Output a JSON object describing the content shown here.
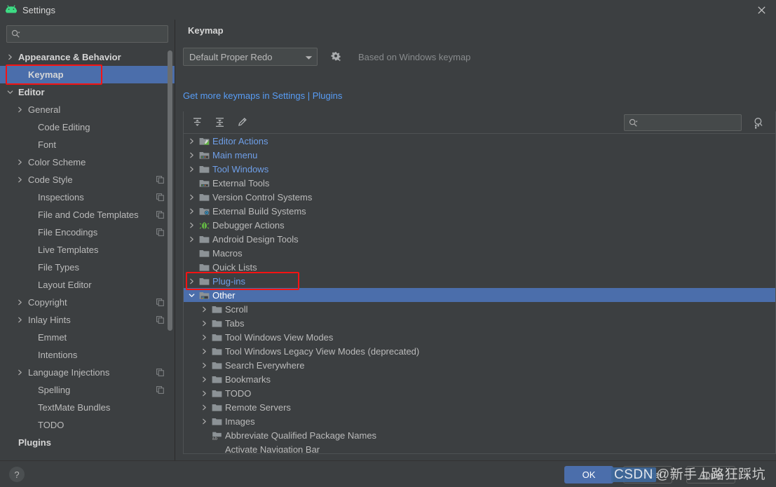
{
  "window": {
    "title": "Settings",
    "logo_icon": "android-studio-logo-icon",
    "close_icon": "close-icon"
  },
  "sidebar": {
    "search": {
      "placeholder": "",
      "value": "",
      "icon": "search-icon"
    },
    "items": [
      {
        "label": "Appearance & Behavior",
        "arrow": "chevron-right",
        "indent": 0,
        "bold": true,
        "selected": false,
        "copy": false
      },
      {
        "label": "Keymap",
        "arrow": "",
        "indent": 1,
        "bold": true,
        "selected": true,
        "copy": false
      },
      {
        "label": "Editor",
        "arrow": "chevron-down",
        "indent": 0,
        "bold": true,
        "selected": false,
        "copy": false
      },
      {
        "label": "General",
        "arrow": "chevron-right",
        "indent": 1,
        "bold": false,
        "selected": false,
        "copy": false
      },
      {
        "label": "Code Editing",
        "arrow": "",
        "indent": 2,
        "bold": false,
        "selected": false,
        "copy": false
      },
      {
        "label": "Font",
        "arrow": "",
        "indent": 2,
        "bold": false,
        "selected": false,
        "copy": false
      },
      {
        "label": "Color Scheme",
        "arrow": "chevron-right",
        "indent": 1,
        "bold": false,
        "selected": false,
        "copy": false
      },
      {
        "label": "Code Style",
        "arrow": "chevron-right",
        "indent": 1,
        "bold": false,
        "selected": false,
        "copy": true
      },
      {
        "label": "Inspections",
        "arrow": "",
        "indent": 2,
        "bold": false,
        "selected": false,
        "copy": true
      },
      {
        "label": "File and Code Templates",
        "arrow": "",
        "indent": 2,
        "bold": false,
        "selected": false,
        "copy": true
      },
      {
        "label": "File Encodings",
        "arrow": "",
        "indent": 2,
        "bold": false,
        "selected": false,
        "copy": true
      },
      {
        "label": "Live Templates",
        "arrow": "",
        "indent": 2,
        "bold": false,
        "selected": false,
        "copy": false
      },
      {
        "label": "File Types",
        "arrow": "",
        "indent": 2,
        "bold": false,
        "selected": false,
        "copy": false
      },
      {
        "label": "Layout Editor",
        "arrow": "",
        "indent": 2,
        "bold": false,
        "selected": false,
        "copy": false
      },
      {
        "label": "Copyright",
        "arrow": "chevron-right",
        "indent": 1,
        "bold": false,
        "selected": false,
        "copy": true
      },
      {
        "label": "Inlay Hints",
        "arrow": "chevron-right",
        "indent": 1,
        "bold": false,
        "selected": false,
        "copy": true
      },
      {
        "label": "Emmet",
        "arrow": "",
        "indent": 2,
        "bold": false,
        "selected": false,
        "copy": false
      },
      {
        "label": "Intentions",
        "arrow": "",
        "indent": 2,
        "bold": false,
        "selected": false,
        "copy": false
      },
      {
        "label": "Language Injections",
        "arrow": "chevron-right",
        "indent": 1,
        "bold": false,
        "selected": false,
        "copy": true
      },
      {
        "label": "Spelling",
        "arrow": "",
        "indent": 2,
        "bold": false,
        "selected": false,
        "copy": true
      },
      {
        "label": "TextMate Bundles",
        "arrow": "",
        "indent": 2,
        "bold": false,
        "selected": false,
        "copy": false
      },
      {
        "label": "TODO",
        "arrow": "",
        "indent": 2,
        "bold": false,
        "selected": false,
        "copy": false
      },
      {
        "label": "Plugins",
        "arrow": "",
        "indent": 0,
        "bold": true,
        "selected": false,
        "copy": false
      }
    ]
  },
  "main": {
    "title": "Keymap",
    "keymap_select": {
      "value": "Default Proper Redo",
      "arrow_icon": "chevron-down-icon"
    },
    "gear_icon": "gear-icon",
    "based_on": "Based on Windows keymap",
    "links": {
      "text": "Get more keymaps in Settings | Plugins"
    },
    "toolbar": {
      "expand_all_icon": "expand-all-icon",
      "collapse_all_icon": "collapse-all-icon",
      "edit_shortcut_icon": "pencil-edit-icon",
      "search_placeholder": "",
      "search_value": "",
      "search_icon": "search-icon",
      "find_actions_icon": "find-action-by-shortcut-icon"
    },
    "tree": [
      {
        "label": "Editor Actions",
        "arrow": "chevron-right",
        "icon": "folder-editor-icon",
        "depth": 0,
        "blue": true,
        "selected": false
      },
      {
        "label": "Main menu",
        "arrow": "chevron-right",
        "icon": "folder-menu-icon",
        "depth": 0,
        "blue": true,
        "selected": false
      },
      {
        "label": "Tool Windows",
        "arrow": "chevron-right",
        "icon": "folder-icon",
        "depth": 0,
        "blue": true,
        "selected": false
      },
      {
        "label": "External Tools",
        "arrow": "",
        "icon": "folder-tools-icon",
        "depth": 0,
        "blue": false,
        "selected": false
      },
      {
        "label": "Version Control Systems",
        "arrow": "chevron-right",
        "icon": "folder-icon",
        "depth": 0,
        "blue": false,
        "selected": false
      },
      {
        "label": "External Build Systems",
        "arrow": "chevron-right",
        "icon": "folder-gear-icon",
        "depth": 0,
        "blue": false,
        "selected": false
      },
      {
        "label": "Debugger Actions",
        "arrow": "chevron-right",
        "icon": "bug-icon",
        "depth": 0,
        "blue": false,
        "selected": false
      },
      {
        "label": "Android Design Tools",
        "arrow": "chevron-right",
        "icon": "folder-icon",
        "depth": 0,
        "blue": false,
        "selected": false
      },
      {
        "label": "Macros",
        "arrow": "",
        "icon": "folder-icon",
        "depth": 0,
        "blue": false,
        "selected": false
      },
      {
        "label": "Quick Lists",
        "arrow": "",
        "icon": "folder-icon",
        "depth": 0,
        "blue": false,
        "selected": false
      },
      {
        "label": "Plug-ins",
        "arrow": "chevron-right",
        "icon": "folder-icon",
        "depth": 0,
        "blue": true,
        "selected": false
      },
      {
        "label": "Other",
        "arrow": "chevron-down",
        "icon": "folder-other-icon",
        "depth": 0,
        "blue": true,
        "selected": true
      },
      {
        "label": "Scroll",
        "arrow": "chevron-right",
        "icon": "folder-icon",
        "depth": 1,
        "blue": false,
        "selected": false
      },
      {
        "label": "Tabs",
        "arrow": "chevron-right",
        "icon": "folder-icon",
        "depth": 1,
        "blue": false,
        "selected": false
      },
      {
        "label": "Tool Windows View Modes",
        "arrow": "chevron-right",
        "icon": "folder-icon",
        "depth": 1,
        "blue": false,
        "selected": false
      },
      {
        "label": "Tool Windows Legacy View Modes (deprecated)",
        "arrow": "chevron-right",
        "icon": "folder-icon",
        "depth": 1,
        "blue": false,
        "selected": false
      },
      {
        "label": "Search Everywhere",
        "arrow": "chevron-right",
        "icon": "folder-icon",
        "depth": 1,
        "blue": false,
        "selected": false
      },
      {
        "label": "Bookmarks",
        "arrow": "chevron-right",
        "icon": "folder-icon",
        "depth": 1,
        "blue": false,
        "selected": false
      },
      {
        "label": "TODO",
        "arrow": "chevron-right",
        "icon": "folder-icon",
        "depth": 1,
        "blue": false,
        "selected": false
      },
      {
        "label": "Remote Servers",
        "arrow": "chevron-right",
        "icon": "folder-icon",
        "depth": 1,
        "blue": false,
        "selected": false
      },
      {
        "label": "Images",
        "arrow": "chevron-right",
        "icon": "folder-icon",
        "depth": 1,
        "blue": false,
        "selected": false
      },
      {
        "label": "Abbreviate Qualified Package Names",
        "arrow": "",
        "icon": "action-ab-icon",
        "depth": 1,
        "blue": false,
        "selected": false
      },
      {
        "label": "Activate Navigation Bar",
        "arrow": "",
        "icon": "",
        "depth": 1,
        "blue": false,
        "selected": false
      }
    ]
  },
  "footer": {
    "help_label": "?",
    "ok_label": "OK",
    "cancel_label": "Cancel",
    "apply_label": "Apply"
  },
  "watermark": {
    "brand": "CSDN",
    "text": "@新手上路狂踩坑"
  },
  "colors": {
    "window_bg": "#3c3f41",
    "selection": "#4b6eab",
    "link": "#589df6",
    "tree_blue": "#6f9fe8",
    "annotation_red": "#f51313",
    "text": "#bbbbbb"
  }
}
